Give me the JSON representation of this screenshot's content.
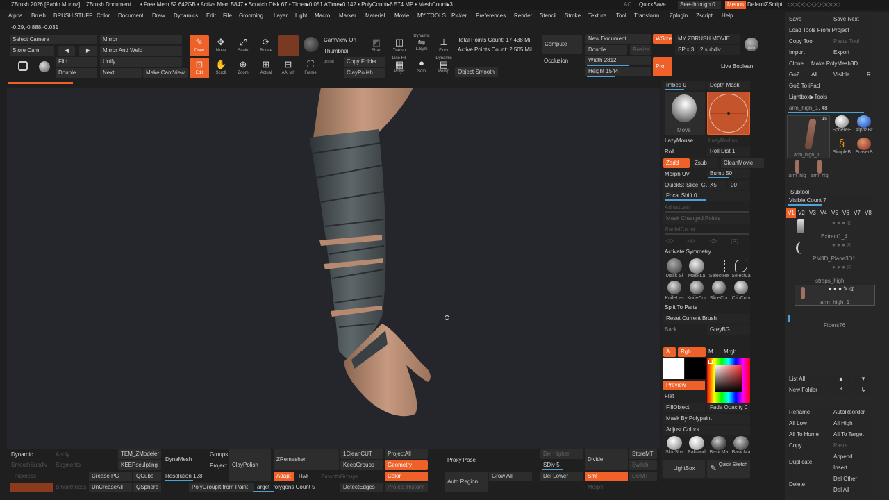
{
  "titlebar": {
    "app": "ZBrush 2026 [Pablo Munoz]",
    "doc": "ZBrush Document",
    "stats": "• Free Mem 52.642GB • Active Mem 5847 • Scratch Disk 67 • Timer▸0.051 ATime▸0.142 • PolyCount▸6.574 MP • MeshCount▸3",
    "ac": "AC",
    "quicksave": "QuickSave",
    "seethrough": "See-through 0",
    "menus": "Menus",
    "script": "DefaultZScript"
  },
  "menubar": [
    "Alpha",
    "Brush",
    "BRUSH STUFF",
    "Color",
    "Document",
    "Draw",
    "Dynamics",
    "Edit",
    "File",
    "Grooming",
    "Layer",
    "Light",
    "Macro",
    "Marker",
    "Material",
    "Movie",
    "MY TOOLS",
    "Picker",
    "Preferences",
    "Render",
    "Stencil",
    "Stroke",
    "Texture",
    "Tool",
    "Transform",
    "Zplugin",
    "Zscript",
    "Help"
  ],
  "coords": "-0.29,-0.888,-0.031",
  "shelf": {
    "select_camera": "Select Camera",
    "store_cam": "Store Cam",
    "mirror": "Mirror",
    "mirror_weld": "Mirror And Weld",
    "flip": "Flip",
    "unify": "Unify",
    "double": "Double",
    "next": "Next",
    "make_camview": "Make CamView",
    "draw": "Draw",
    "move": "Move",
    "scale": "Scale",
    "rotate": "Rotate",
    "edit": "Edit",
    "scroll": "Scroll",
    "zoom": "Zoom",
    "actual": "Actual",
    "aahalf": "AAHalf",
    "frame": "Frame",
    "camview_on": "CamView On",
    "thumbnail": "Thumbnail",
    "copy_folder": "Copy Folder",
    "claypolish": "ClayPolish",
    "shad": "Shad",
    "transp": "Transp",
    "dynamic_lsym": "Dynamic",
    "lsym": "L.Sym",
    "floor": "Floor",
    "linefill": "Line Fill",
    "polyf": "PolyF",
    "solo": "Solo",
    "dynamic": "Dynamic",
    "persp": "Persp",
    "object_smooth": "Object Smooth",
    "total_points": "Total Points Count: 17.438 Mil",
    "active_points": "Active Points Count: 2.505 Mil",
    "compute": "Compute",
    "occlusion": "Occlusion",
    "new_document": "New Document",
    "double_doc": "Double",
    "resize": "Resize",
    "width_label": "Width",
    "width_val": "2812",
    "height_label": "Height",
    "height_val": "1544",
    "wsize": "WSize",
    "pro": "Pro",
    "my_movie": "MY ZBRUSH MOVIE",
    "spix": "SPix",
    "spix_val": "3",
    "subdiv": "2 subdiv",
    "bpr": "BPR",
    "live_boolean": "Live Boolean"
  },
  "right_brush": {
    "imbed_label": "Imbed",
    "imbed_val": "0",
    "depth_mask": "Depth Mask",
    "move_label": "Move",
    "lazymouse": "LazyMouse",
    "lazyradius": "LazyRadius",
    "roll": "Roll",
    "roll_dist": "Roll Dist",
    "roll_dist_val": "1",
    "zadd": "Zadd",
    "zsub": "Zsub",
    "cleanmovie": "CleanMovie",
    "morph_uv": "Morph UV",
    "bump": "Bump",
    "bump_val": "50",
    "quicksc": "QuickSc",
    "slice_c": "Slice_Cu",
    "x5": "X5",
    "zero0": "00",
    "focal_shift": "Focal Shift",
    "focal_val": "0",
    "adjustlast": "AdjustLast",
    "mask_changed": "Mask Changed Points",
    "radialcount": "RadialCount",
    "sym_x": ">X<",
    "sym_y": ">Y<",
    "sym_z": ">Z<",
    "sym_r": "(R)",
    "activate_sym": "Activate Symmetry",
    "brushes": [
      "Mask Sl",
      "MaskLa",
      "SelectRe",
      "SelectLa",
      "KnifeLas",
      "KnifeCur",
      "SliceCur",
      "ClipCurv"
    ],
    "split_parts": "Split To Parts",
    "reset_brush": "Reset Current Brush",
    "back": "Back",
    "greybg": "GreyBG",
    "a": "A",
    "rgb": "Rgb",
    "m": "M",
    "mrgb": "Mrgb",
    "preview": "Preview",
    "flat": "Flat",
    "fillobject": "FillObject",
    "fade_opacity": "Fade Opacity",
    "fade_val": "0",
    "mask_polypaint": "Mask By Polypaint",
    "adjust_colors": "Adjust Colors",
    "materials": [
      "SkinSha",
      "Pabland",
      "BasicMa",
      "BasicMa"
    ],
    "lightbox": "LightBox",
    "quick_sketch": "Quick Sketch"
  },
  "tool_panel": {
    "save": "Save",
    "save_next": "Save Next",
    "load_project": "Load Tools From Project",
    "copy_tool": "Copy Tool",
    "paste_tool": "Paste Tool",
    "import": "Import",
    "export": "Export",
    "clone": "Clone",
    "make_polymesh": "Make PolyMesh3D",
    "goz": "GoZ",
    "all": "All",
    "visible": "Visible",
    "r": "R",
    "goz_ipad": "GoZ To iPad",
    "lightbox_tools": "Lightbox▶Tools",
    "arm_high": "arm_high_1",
    "arm_val": "48",
    "thumb_count": "15",
    "thumbs": [
      "SphereE",
      "AlphaBr",
      "SimpleB",
      "EraserB"
    ],
    "thumb_main": "arm_high_1",
    "thumb_small": [
      "arm_hig",
      "arm_hig"
    ],
    "subtool": "Subtool",
    "visible_count": "Visible Count",
    "visible_count_val": "7",
    "versions": [
      "V1",
      "V2",
      "V3",
      "V4",
      "V5",
      "V6",
      "V7",
      "V8"
    ],
    "subtools": [
      "Extract1_4",
      "PM3D_Plane3D1",
      "straps_high",
      "arm_high_1",
      "Fibers76"
    ],
    "list_all": "List All",
    "new_folder": "New Folder",
    "rename": "Rename",
    "autoreorder": "AutoReorder",
    "all_low": "All Low",
    "all_high": "All High",
    "all_to_home": "All To Home",
    "all_to_target": "All To Target",
    "copy": "Copy",
    "paste": "Paste",
    "duplicate": "Duplicate",
    "append": "Append",
    "insert": "Insert",
    "delete": "Delete",
    "del_other": "Del Other",
    "del_all": "Del All"
  },
  "bottom": {
    "dynamic": "Dynamic",
    "apply": "Apply",
    "smoothsubdiv": "SmoothSubdiv",
    "segments": "Segments",
    "thickness": "Thickness",
    "smoothness": "Smoothness",
    "tem_zmodeler": "TEM_ZModeler",
    "keepsculpting": "KEEPsculpting",
    "crease_pg": "Crease PG",
    "qcube": "QCube",
    "uncreaseall": "UnCreaseAll",
    "qsphere": "QSphere",
    "dynamesh": "DynaMesh",
    "groups": "Groups",
    "project": "Project",
    "claypolish": "ClayPolish",
    "resolution": "Resolution",
    "resolution_val": "128",
    "polygroupit": "PolyGroupIt from Paint",
    "zremesher": "ZRemesher",
    "adapt": "Adapt",
    "half": "Half",
    "smoothgroups": "SmoothGroups",
    "target_poly": "Target Polygons Count",
    "target_val": "5",
    "oneclean": "1CleanCUT",
    "keepgroups": "KeepGroups",
    "detectedges": "DetectEdges",
    "projectall": "ProjectAll",
    "geometry": "Geometry",
    "color": "Color",
    "project_history": "Project History",
    "proxy_pose": "Proxy Pose",
    "auto_region": "Auto Region",
    "grow_all": "Grow All",
    "del_higher": "Del Higher",
    "sdiv": "SDiv",
    "sdiv_val": "5",
    "del_lower": "Del Lower",
    "divide": "Divide",
    "smt": "Smt",
    "morph": "Morph",
    "storemt": "StoreMT",
    "switch": "Switch",
    "delmt": "DelMT"
  },
  "colors": {
    "accent": "#f0612a",
    "slider": "#49a3d8",
    "bg": "#1f1f1f",
    "canvas": "#25262b"
  }
}
